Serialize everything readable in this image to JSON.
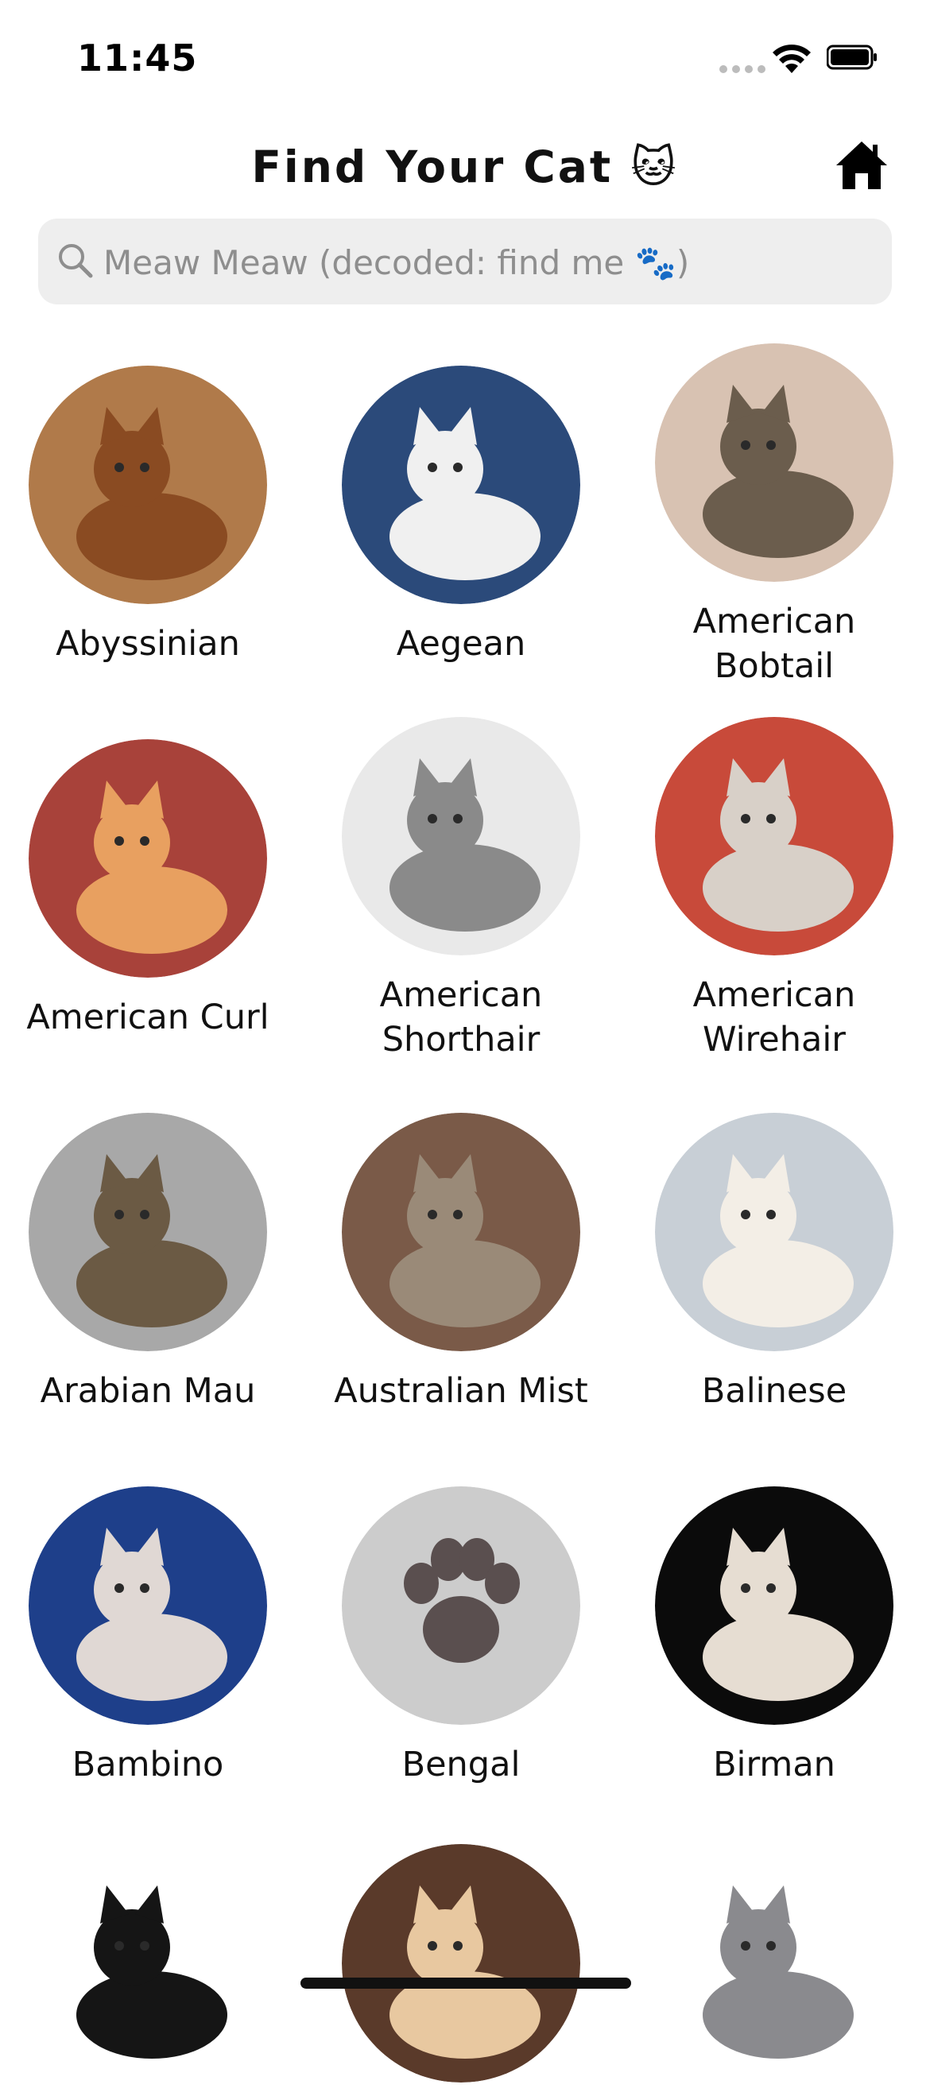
{
  "status_bar": {
    "time": "11:45"
  },
  "header": {
    "title": "Find Your Cat 🐱",
    "home_icon": "home-icon"
  },
  "search": {
    "placeholder": "Meaw Meaw (decoded: find me 🐾)",
    "value": ""
  },
  "breeds": [
    {
      "name": "Abyssinian",
      "image": "photo",
      "bg": "#b07a4a",
      "fg": "#8a4b22"
    },
    {
      "name": "Aegean",
      "image": "photo",
      "bg": "#2b4a7a",
      "fg": "#f0f0f0"
    },
    {
      "name": "American Bobtail",
      "image": "photo",
      "bg": "#d8c2b2",
      "fg": "#6b5d4d"
    },
    {
      "name": "American Curl",
      "image": "photo",
      "bg": "#a8423a",
      "fg": "#e8a060"
    },
    {
      "name": "American Shorthair",
      "image": "photo",
      "bg": "#e9e9e9",
      "fg": "#8a8a8a"
    },
    {
      "name": "American Wirehair",
      "image": "photo",
      "bg": "#c84a3a",
      "fg": "#d8d0c8"
    },
    {
      "name": "Arabian Mau",
      "image": "photo",
      "bg": "#a8a8a8",
      "fg": "#6b5a44"
    },
    {
      "name": "Australian Mist",
      "image": "photo",
      "bg": "#7a5a48",
      "fg": "#9a8a78"
    },
    {
      "name": "Balinese",
      "image": "photo",
      "bg": "#c8cfd6",
      "fg": "#f3eee6"
    },
    {
      "name": "Bambino",
      "image": "photo",
      "bg": "#1e3f8a",
      "fg": "#e0d8d4"
    },
    {
      "name": "Bengal",
      "image": "paw-placeholder",
      "bg": "#cccccc",
      "fg": "#5a4f4f"
    },
    {
      "name": "Birman",
      "image": "photo",
      "bg": "#0b0b0b",
      "fg": "#e6ddd2"
    },
    {
      "name": "",
      "image": "photo",
      "bg": "#ffffff",
      "fg": "#151515"
    },
    {
      "name": "",
      "image": "photo",
      "bg": "#5a3a2a",
      "fg": "#e8c8a0"
    },
    {
      "name": "",
      "image": "photo",
      "bg": "#ffffff",
      "fg": "#8a8a8e"
    }
  ]
}
